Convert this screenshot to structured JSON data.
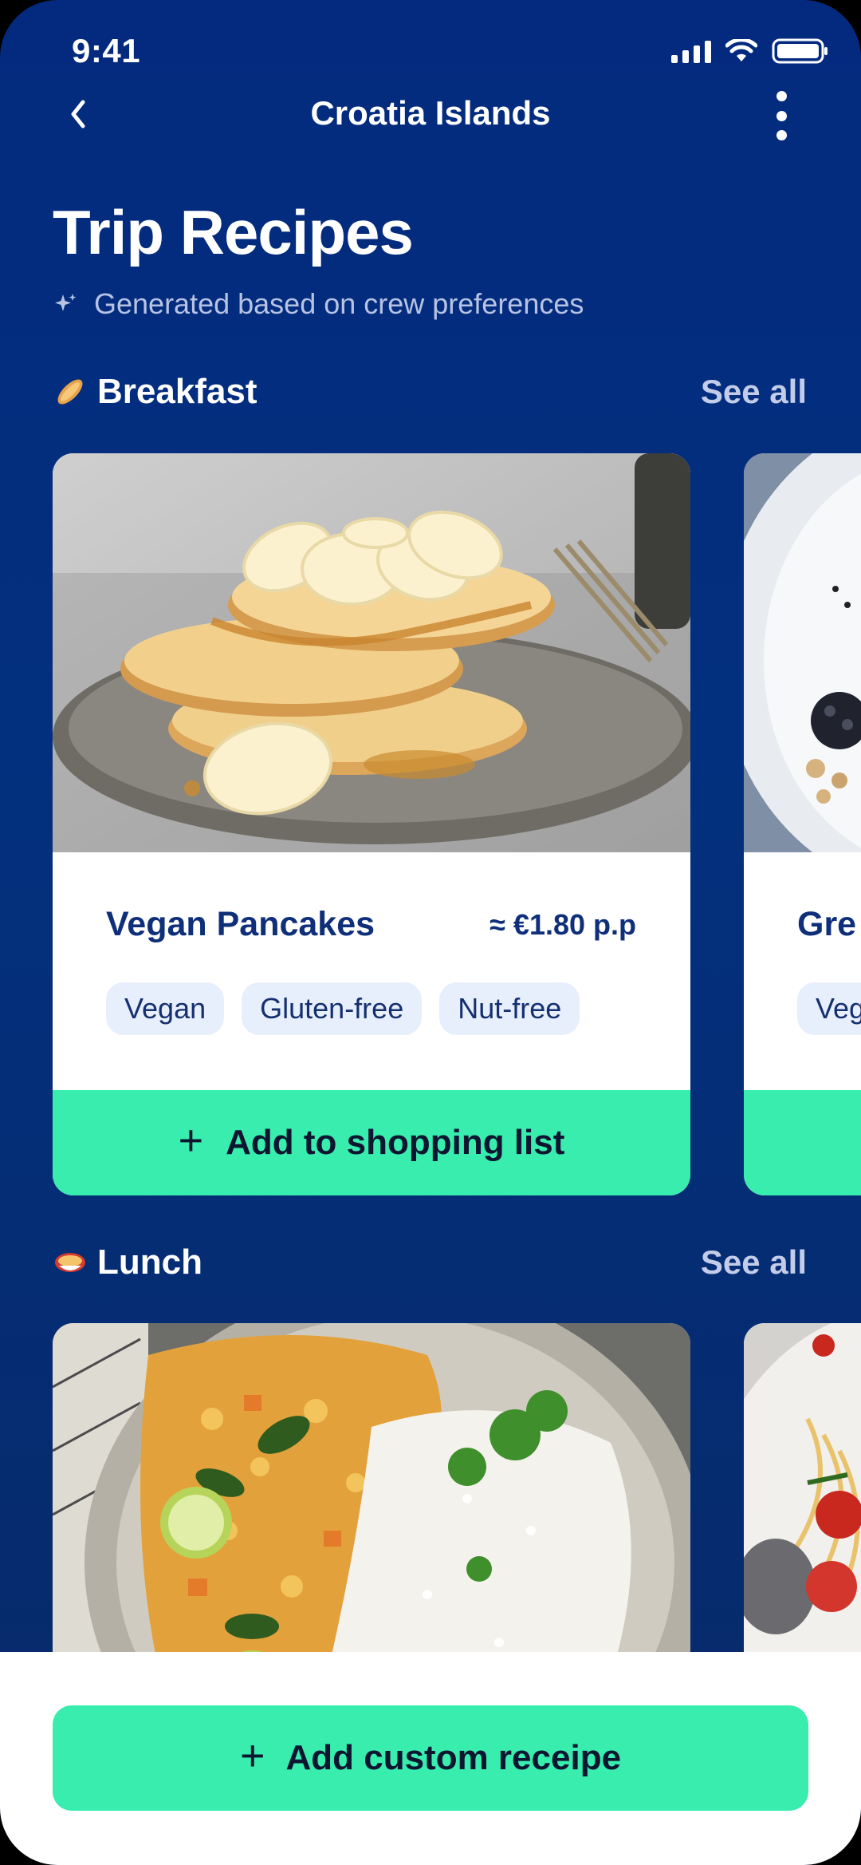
{
  "status_bar": {
    "time": "9:41"
  },
  "nav": {
    "title": "Croatia Islands"
  },
  "header": {
    "title": "Trip Recipes",
    "subtitle": "Generated based on crew preferences"
  },
  "sections": [
    {
      "title": "Breakfast",
      "see_all": "See all",
      "cards": [
        {
          "name": "Vegan Pancakes",
          "price": "≈ €1.80 p.p",
          "tags": [
            "Vegan",
            "Gluten-free",
            "Nut-free"
          ],
          "cta": "Add to shopping list"
        },
        {
          "name": "Gre",
          "tags": [
            "Veg"
          ]
        }
      ]
    },
    {
      "title": "Lunch",
      "see_all": "See all"
    }
  ],
  "bottom": {
    "cta": "Add custom receipe"
  },
  "colors": {
    "background": "#032a7e",
    "accent": "#38edad",
    "title_text": "#0f2f7a",
    "tag_bg": "#e7eefc"
  }
}
